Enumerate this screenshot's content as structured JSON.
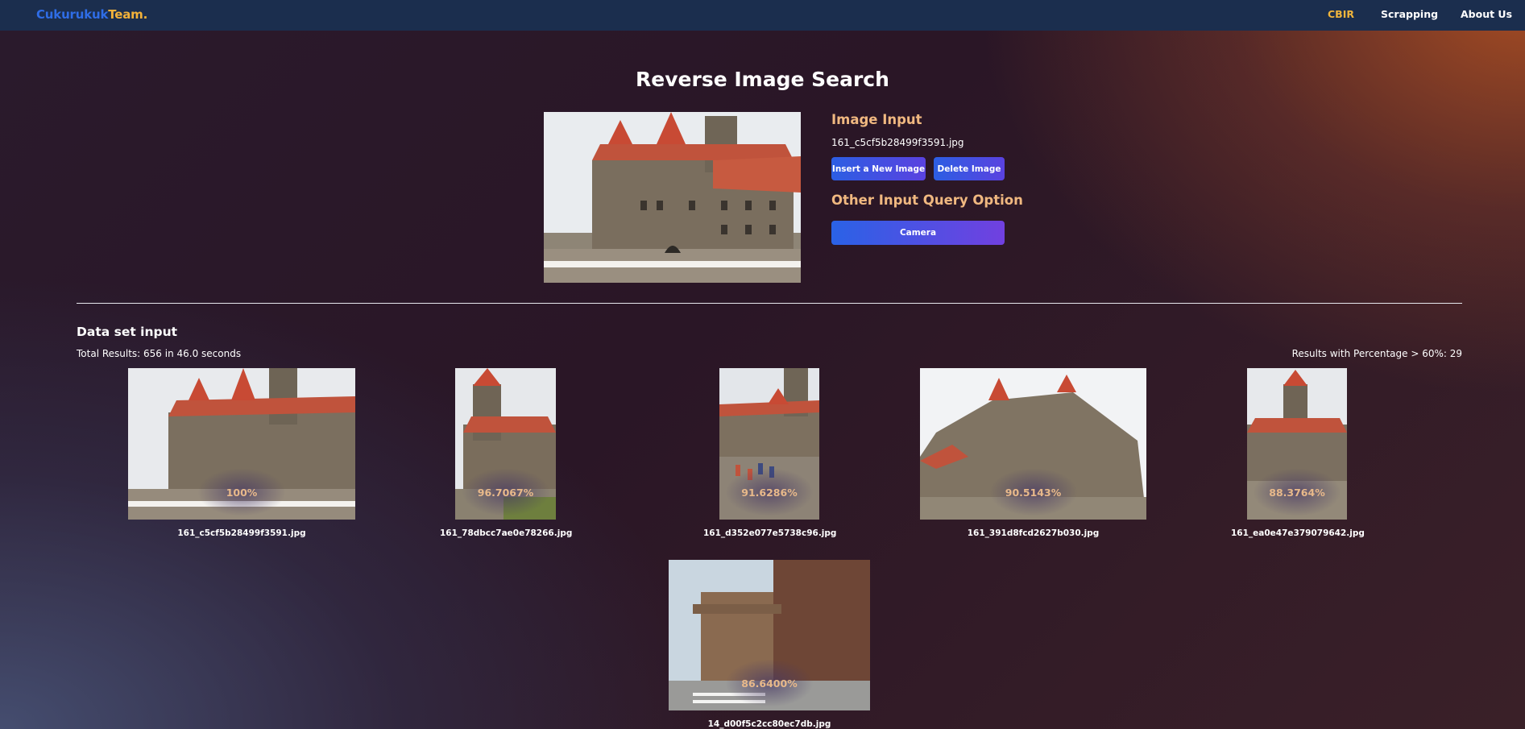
{
  "brand": {
    "part1": "Cukurukuk",
    "part2": "Team."
  },
  "nav": {
    "items": [
      "CBIR",
      "Scrapping",
      "About Us"
    ],
    "active": "CBIR"
  },
  "page": {
    "title": "Reverse Image Search"
  },
  "query": {
    "section_label": "Image Input",
    "filename": "161_c5cf5b28499f3591.jpg",
    "insert_button": "Insert a New Image",
    "delete_button": "Delete Image",
    "other_label": "Other Input Query Option",
    "camera_button": "Camera"
  },
  "dataset": {
    "title": "Data set input",
    "total_results": "Total Results: 656 in 46.0 seconds",
    "percentage_results": "Results with Percentage > 60%: 29"
  },
  "results": [
    {
      "filename": "161_c5cf5b28499f3591.jpg",
      "percentage": "100%"
    },
    {
      "filename": "161_78dbcc7ae0e78266.jpg",
      "percentage": "96.7067%"
    },
    {
      "filename": "161_d352e077e5738c96.jpg",
      "percentage": "91.6286%"
    },
    {
      "filename": "161_391d8fcd2627b030.jpg",
      "percentage": "90.5143%"
    },
    {
      "filename": "161_ea0e47e379079642.jpg",
      "percentage": "88.3764%"
    },
    {
      "filename": "14_d00f5c2cc80ec7db.jpg",
      "percentage": "86.6400%"
    }
  ],
  "colors": {
    "navbar": "#1b2e4e",
    "brand_blue": "#2f6de6",
    "brand_gold": "#f3b23a",
    "accent_label": "#f0b880",
    "button_start": "#2c5ee3",
    "button_end": "#5a42e0"
  }
}
